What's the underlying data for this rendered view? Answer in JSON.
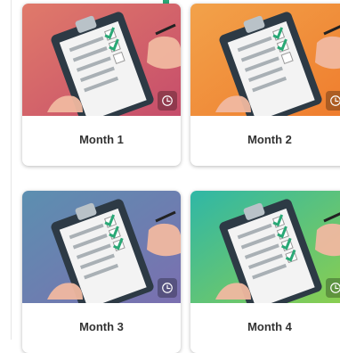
{
  "cards": [
    {
      "title": "Month 1",
      "bg_from": "#e07a6a",
      "bg_to": "#c64d6b"
    },
    {
      "title": "Month 2",
      "bg_from": "#f2a24a",
      "bg_to": "#ef7c2d"
    },
    {
      "title": "Month 3",
      "bg_from": "#5c8fb0",
      "bg_to": "#7b6fb0"
    },
    {
      "title": "Month 4",
      "bg_from": "#2fb7a6",
      "bg_to": "#8ccf4e"
    }
  ],
  "icons": {
    "illustration": "clipboard-checklist-icon",
    "badge": "clock-icon"
  },
  "accent_color": "#2aa876"
}
